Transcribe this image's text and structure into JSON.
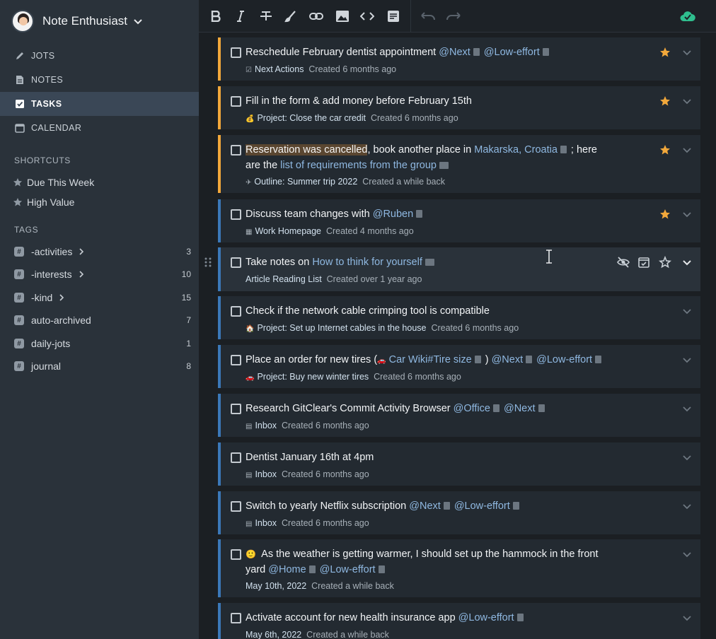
{
  "account": {
    "name": "Note Enthusiast"
  },
  "nav": [
    {
      "label": "JOTS",
      "icon": "pencil-icon"
    },
    {
      "label": "NOTES",
      "icon": "note-icon"
    },
    {
      "label": "TASKS",
      "icon": "tasks-icon"
    },
    {
      "label": "CALENDAR",
      "icon": "calendar-icon"
    }
  ],
  "shortcuts": {
    "title": "SHORTCUTS",
    "items": [
      "Due This Week",
      "High Value"
    ]
  },
  "tags": {
    "title": "TAGS",
    "items": [
      {
        "name": "-activities",
        "count": "3"
      },
      {
        "name": "-interests",
        "count": "10"
      },
      {
        "name": "-kind",
        "count": "15"
      },
      {
        "name": "auto-archived",
        "count": "7"
      },
      {
        "name": "daily-jots",
        "count": "1"
      },
      {
        "name": "journal",
        "count": "8"
      }
    ]
  },
  "toolbar": [
    "bold-icon",
    "italic-icon",
    "strikethrough-icon",
    "highlight-icon",
    "link-icon",
    "image-icon",
    "code-icon",
    "block-icon",
    "undo-icon",
    "redo-icon",
    "cloud-sync-icon"
  ],
  "colors": {
    "accent_orange": "#f2a83b",
    "accent_blue": "#3b78b8",
    "star": "#f2a83b",
    "sync": "#2fbf8f",
    "link": "#8fb8e1"
  },
  "tasks": [
    {
      "line1": {
        "pre": "Reschedule February dentist appointment ",
        "link1": "@Next",
        "link2": "@Low-effort"
      },
      "meta": {
        "project": "Next Actions",
        "created": "Created 6 months ago"
      }
    },
    {
      "line1": {
        "pre": "Fill in the form & add money before February 15th"
      },
      "meta": {
        "project": "Project: Close the car credit",
        "created": "Created 6 months ago"
      }
    },
    {
      "line1": {
        "hl": "Reservation was cancelled",
        "mid": ", book another place in ",
        "link1": "Makarska, Croatia",
        "post": "; here"
      },
      "line2": {
        "pre": "are the ",
        "link1": "list of requirements from the group"
      },
      "meta": {
        "project": "Outline: Summer trip 2022",
        "created": "Created a while back"
      }
    },
    {
      "line1": {
        "pre": "Discuss team changes with ",
        "link1": "@Ruben"
      },
      "meta": {
        "project": "Work Homepage",
        "created": "Created 4 months ago"
      }
    },
    {
      "line1": {
        "pre": "Take notes on ",
        "link1": "How to think for yourself"
      },
      "meta": {
        "project": "Article Reading List",
        "created": "Created over 1 year ago"
      }
    },
    {
      "line1": {
        "pre": "Check if the network cable crimping tool is compatible"
      },
      "meta": {
        "project": "Project: Set up Internet cables in the house",
        "created": "Created 6 months ago"
      }
    },
    {
      "line1": {
        "pre": "Place an order for new tires (",
        "link1": "Car Wiki#Tire size",
        "mid": ") ",
        "link2": "@Next",
        "link3": "@Low-effort"
      },
      "meta": {
        "project": "Project: Buy new winter tires",
        "created": "Created 6 months ago"
      }
    },
    {
      "line1": {
        "pre": "Research GitClear's Commit Activity Browser ",
        "link1": "@Office",
        "link2": "@Next"
      },
      "meta": {
        "project": "Inbox",
        "created": "Created 6 months ago"
      }
    },
    {
      "line1": {
        "pre": "Dentist January 16th at 4pm"
      },
      "meta": {
        "project": "Inbox",
        "created": "Created 6 months ago"
      }
    },
    {
      "line1": {
        "pre": "Switch to yearly Netflix subscription ",
        "link1": "@Next",
        "link2": "@Low-effort"
      },
      "meta": {
        "project": "Inbox",
        "created": "Created 6 months ago"
      }
    },
    {
      "line1": {
        "pre": " As the weather is getting warmer, I should set up the hammock in the front"
      },
      "line2": {
        "pre": "yard ",
        "link1": "@Home",
        "link2": "@Low-effort"
      },
      "meta": {
        "project": "May 10th, 2022",
        "created": "Created a while back"
      }
    },
    {
      "line1": {
        "pre": "Activate account for new health insurance app ",
        "link1": "@Low-effort"
      },
      "meta": {
        "project": "May 6th, 2022",
        "created": "Created a while back"
      }
    }
  ]
}
